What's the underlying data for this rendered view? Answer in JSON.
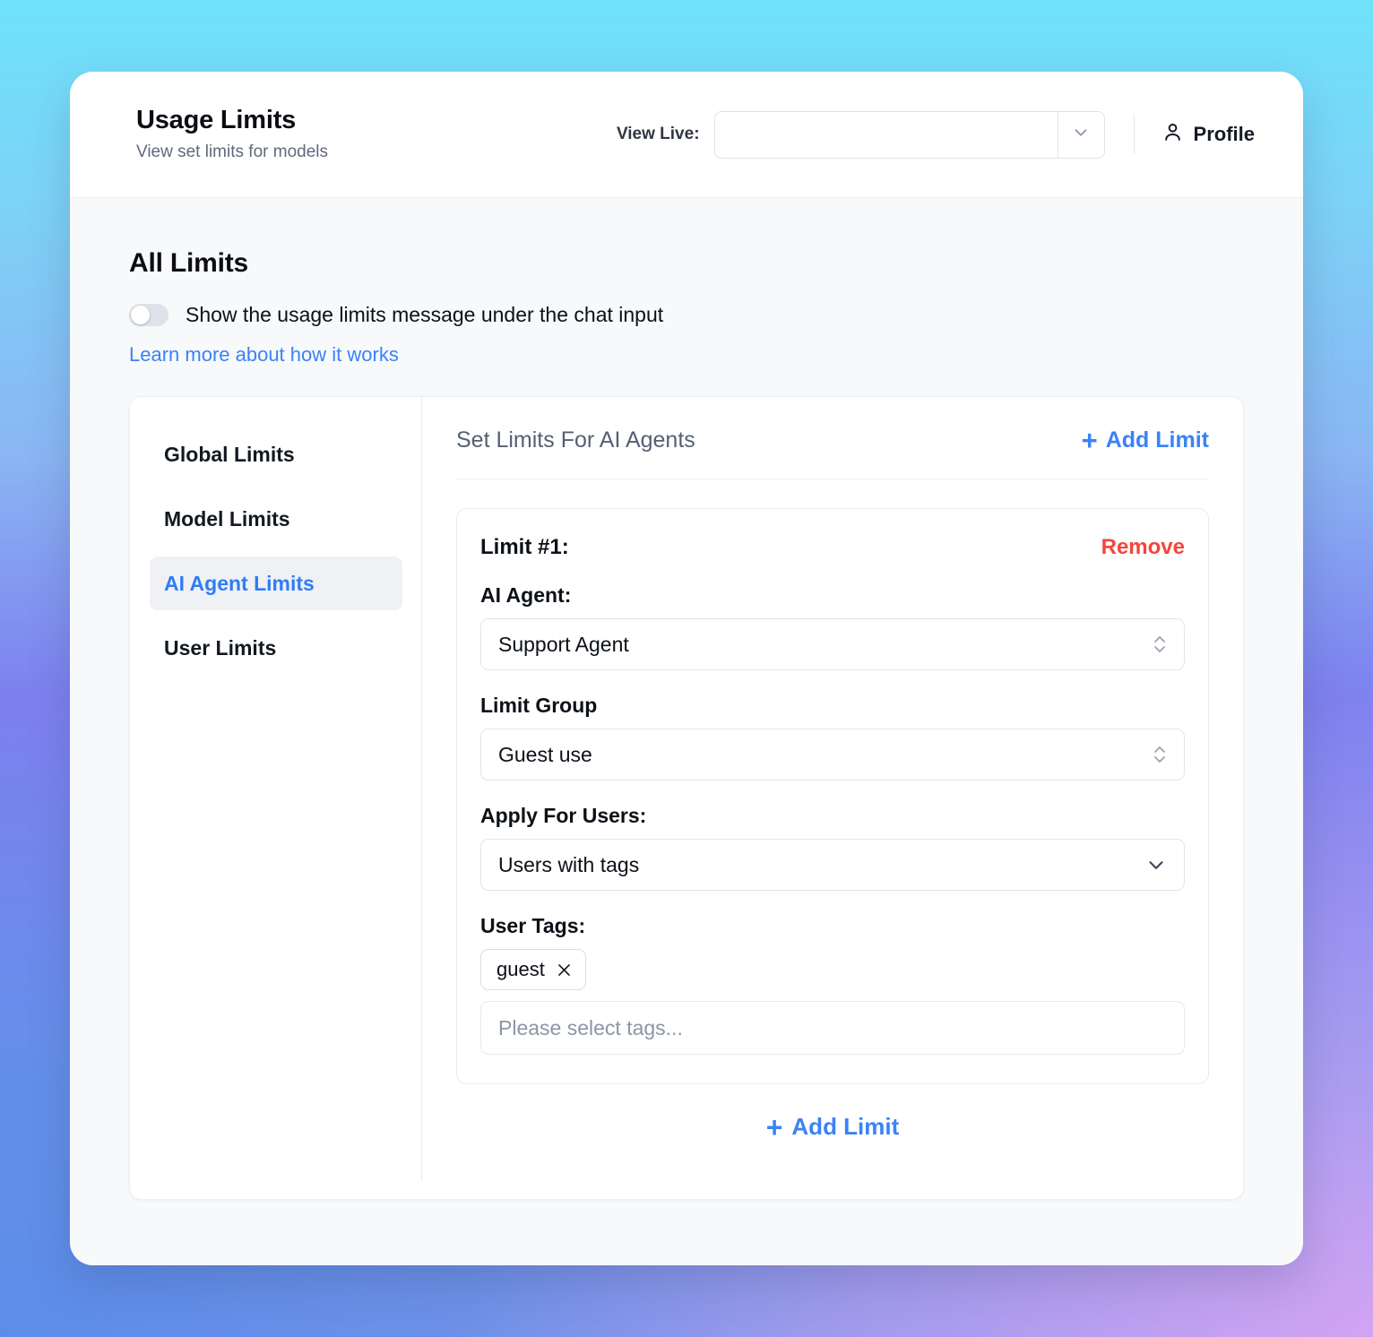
{
  "header": {
    "title": "Usage Limits",
    "subtitle": "View set limits for models",
    "view_live_label": "View Live:",
    "view_live_value": "",
    "view_live_placeholder": "",
    "profile_label": "Profile",
    "icons": {
      "dropdown": "chevron-down-icon",
      "profile": "person-icon"
    }
  },
  "all_limits": {
    "section_title": "All Limits",
    "toggle_label": "Show the usage limits message under the chat input",
    "toggle_state": "off",
    "learn_more_link": "Learn more about how it works"
  },
  "sidebar": {
    "items": [
      {
        "label": "Global Limits",
        "active": false
      },
      {
        "label": "Model Limits",
        "active": false
      },
      {
        "label": "AI Agent Limits",
        "active": true
      },
      {
        "label": "User Limits",
        "active": false
      }
    ]
  },
  "main": {
    "title": "Set Limits For AI Agents",
    "add_limit_top": "Add Limit",
    "add_limit_bottom": "Add Limit",
    "plus_glyph": "+",
    "limits": [
      {
        "number_label": "Limit #1:",
        "remove_label": "Remove",
        "ai_agent_label": "AI Agent:",
        "ai_agent_value": "Support Agent",
        "limit_group_label": "Limit Group",
        "limit_group_value": "Guest use",
        "apply_for_users_label": "Apply For Users:",
        "apply_for_users_value": "Users with tags",
        "user_tags_label": "User Tags:",
        "tags": [
          "guest"
        ],
        "tags_placeholder": "Please select tags..."
      }
    ]
  },
  "colors": {
    "accent_blue": "#3b82f6",
    "danger_red": "#f4453c",
    "active_nav_bg": "#eff1f5",
    "body_bg": "#f7f9fb",
    "border": "#e2e5ea"
  }
}
